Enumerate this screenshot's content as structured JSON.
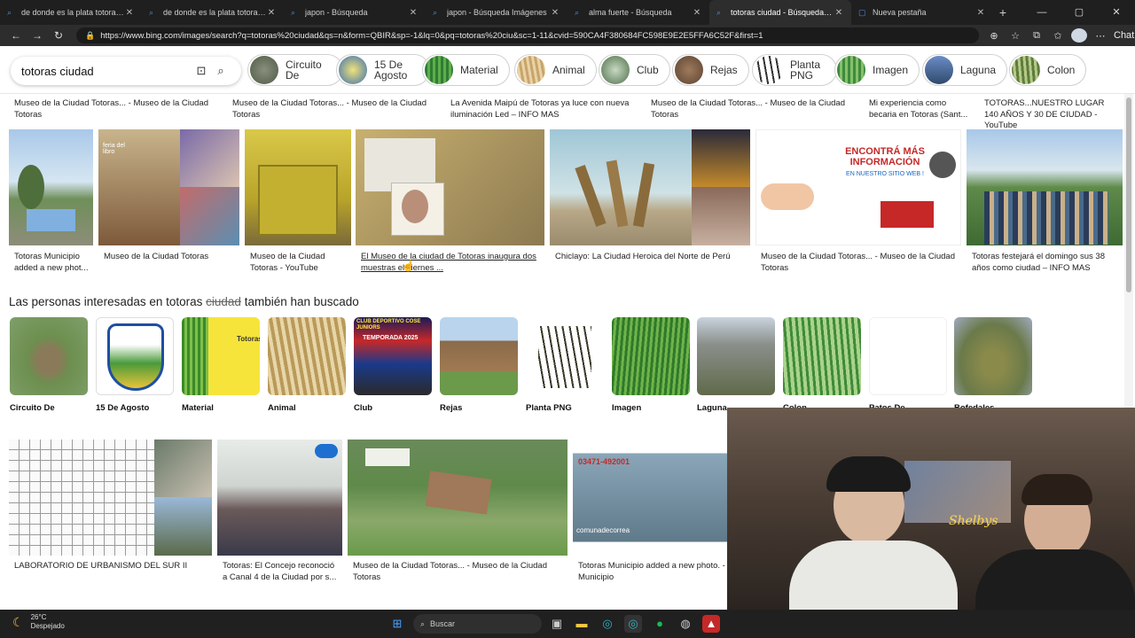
{
  "tabs": [
    {
      "title": "de donde es la plata totoras - Búsqueda"
    },
    {
      "title": "de donde es la plata totoras - Búsqueda"
    },
    {
      "title": "japon - Búsqueda"
    },
    {
      "title": "japon - Búsqueda Imágenes"
    },
    {
      "title": "alma fuerte - Búsqueda"
    },
    {
      "title": "totoras ciudad - Búsqueda Imágenes"
    },
    {
      "title": "Nueva pestaña"
    }
  ],
  "address": {
    "url": "https://www.bing.com/images/search?q=totoras%20ciudad&qs=n&form=QBIR&sp=-1&lq=0&pq=totoras%20ciu&sc=1-11&cvid=590CA4F380684FC598E9E2E5FFA6C52F&first=1",
    "chat_label": "Chat"
  },
  "search": {
    "query": "totoras ciudad"
  },
  "chips": [
    {
      "label": "Circuito De"
    },
    {
      "label": "15 De Agosto"
    },
    {
      "label": "Material"
    },
    {
      "label": "Animal"
    },
    {
      "label": "Club"
    },
    {
      "label": "Rejas"
    },
    {
      "label": "Planta PNG"
    },
    {
      "label": "Imagen"
    },
    {
      "label": "Laguna"
    },
    {
      "label": "Colon"
    }
  ],
  "top_captions": [
    "Museo de la Ciudad Totoras... - Museo de la Ciudad Totoras",
    "Museo de la Ciudad Totoras... - Museo de la Ciudad Totoras",
    "La Avenida Maipú de Totoras ya luce con nueva iluminación Led – INFO MAS",
    "Museo de la Ciudad Totoras... - Museo de la Ciudad Totoras",
    "Mi experiencia como becaria en Totoras (Sant...",
    "TOTORAS...NUESTRO LUGAR 140 AÑOS Y 30 DE CIUDAD - YouTube"
  ],
  "row1": [
    {
      "caption": "Totoras Municipio added a new phot..."
    },
    {
      "caption": "Museo de la Ciudad Totoras"
    },
    {
      "caption": "Museo de la Ciudad Totoras - YouTube"
    },
    {
      "caption": "El Museo de la ciudad de Totoras inaugura dos muestras el viernes ..."
    },
    {
      "caption": "Chiclayo: La Ciudad Heroica del Norte de Perú"
    },
    {
      "caption": "Museo de la Ciudad Totoras... - Museo de la Ciudad Totoras"
    },
    {
      "caption": "Totoras festejará el domingo sus 38 años como ciudad – INFO MAS"
    }
  ],
  "related": {
    "title_prefix": "Las personas interesadas en totoras",
    "title_struck": "ciudad",
    "title_suffix": "también han buscado",
    "items": [
      {
        "label": "Circuito De"
      },
      {
        "label": "15 De Agosto"
      },
      {
        "label": "Material"
      },
      {
        "label": "Animal"
      },
      {
        "label": "Club"
      },
      {
        "label": "Rejas"
      },
      {
        "label": "Planta PNG"
      },
      {
        "label": "Imagen"
      },
      {
        "label": "Laguna"
      },
      {
        "label": "Colon"
      },
      {
        "label": "Patos De"
      },
      {
        "label": "Bofedales"
      }
    ]
  },
  "row2": [
    {
      "caption": "LABORATORIO DE URBANISMO DEL SUR II"
    },
    {
      "caption": "Totoras: El Concejo reconoció a Canal 4 de la Ciudad por s..."
    },
    {
      "caption": "Museo de la Ciudad Totoras... - Museo de la Ciudad Totoras"
    },
    {
      "caption": "Totoras Municipio added a new photo. - Municipio"
    }
  ],
  "image_texts": {
    "feria_libro": "feria del libro",
    "encontra": "ENCONTRÁ MÁS INFORMACIÓN",
    "nuevo_sitio": "EN NUESTRO SITIO WEB !",
    "phone": "03471-492001",
    "handle": "comunadecorrea",
    "club_banner": "CLUB DEPORTIVO COSE JUNIORS",
    "temporada": "TEMPORADA 2025",
    "totoras_word": "Totoras"
  },
  "taskbar": {
    "temp": "26°C",
    "weather": "Despejado",
    "search_label": "Buscar"
  },
  "colors": {
    "chrome_dark": "#1f1f1f",
    "accent": "#4a90e2"
  }
}
